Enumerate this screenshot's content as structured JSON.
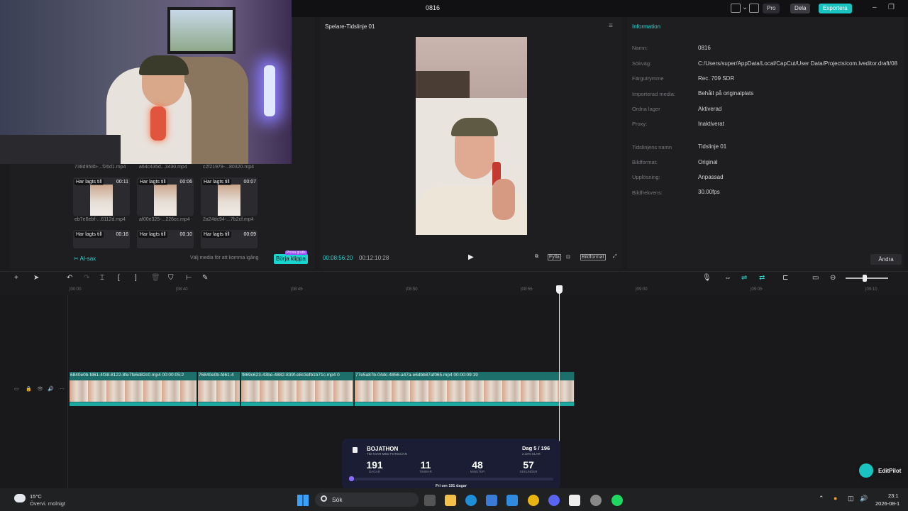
{
  "window": {
    "title": "0816",
    "pro_label": "Pro",
    "share_label": "Dela",
    "export_label": "Exportera"
  },
  "media": {
    "thumbs": [
      {
        "badge": "Har lagts till",
        "duration": "00:11",
        "filename": "eb7e6ebf-...6112d.mp4"
      },
      {
        "badge": "Har lagts till",
        "duration": "00:06",
        "filename": "af00e325-...226cc.mp4"
      },
      {
        "badge": "Har lagts till",
        "duration": "00:07",
        "filename": "2a24dc94-...7b2cf.mp4"
      },
      {
        "badge": "Har lagts till",
        "duration": "00:16",
        "filename": ""
      },
      {
        "badge": "Har lagts till",
        "duration": "00:10",
        "filename": ""
      },
      {
        "badge": "Har lagts till",
        "duration": "00:09",
        "filename": ""
      }
    ],
    "top_filenames": [
      "738d958b-...f26d1.mp4",
      "a64c435d...3430.mp4",
      "c2f21979-...80320.mp4"
    ],
    "ai_label": "AI-sax",
    "hint": "Välj media för att komma igång",
    "start_button": "Börja klippa",
    "trial_badge": "Prova gratis"
  },
  "player": {
    "title": "Spelare-Tidslinje 01",
    "current_time": "00:08:56:20",
    "total_time": "00:12:10:28",
    "fullscreen_label": "Fylla",
    "ratio_label": "Bildformat"
  },
  "info": {
    "title": "Information",
    "rows": [
      {
        "label": "Namn:",
        "value": "0816"
      },
      {
        "label": "Sökväg:",
        "value": "C:/Users/super/AppData/Local/CapCut/User Data/Projects/com.lveditor.draft/08"
      },
      {
        "label": "Färgutrymme",
        "value": "Rec. 709 SDR"
      },
      {
        "label": "Importerad media:",
        "value": "Behåll på originalplats"
      },
      {
        "label": "Ordna lager",
        "value": "Aktiverad"
      },
      {
        "label": "Proxy:",
        "value": "Inaktiverat"
      },
      {
        "label": "Tidslinjens namn",
        "value": "Tidslinje 01"
      },
      {
        "label": "Bildformat:",
        "value": "Original"
      },
      {
        "label": "Upplösning:",
        "value": "Anpassad"
      },
      {
        "label": "Bildfrekvens:",
        "value": "30.00fps"
      }
    ],
    "edit_button": "Ändra"
  },
  "timeline": {
    "ruler_ticks": [
      "|00:00",
      "|08:40",
      "|08:45",
      "|08:50",
      "|08:55",
      "|09:00",
      "|09:05",
      "|09:10"
    ],
    "clips": [
      {
        "label": "6840e0b-fd61-4f38-8122-8fe7fe6d82c0.mp4  00:00:05:2"
      },
      {
        "label": "76840e0b-fd61-4"
      },
      {
        "label": "f869c623-43be-4882-839f-e8c3efb1b71c.mp4  0"
      },
      {
        "label": "77e5a87b-04dc-4856-a47a-e6dbb87af065.mp4  00:00:09:19"
      }
    ]
  },
  "bojathon": {
    "title": "BOJATHON",
    "subtitle": "TID KVAR MED FOTBOJAN",
    "day": "Dag 5 / 196",
    "done": "2.33% KLAR",
    "days": "191",
    "days_label": "DAGAR",
    "hours": "11",
    "hours_label": "TIMMAR",
    "minutes": "48",
    "minutes_label": "MINUTER",
    "seconds": "57",
    "seconds_label": "SEKUNDER",
    "footer": "Fri om 191 dagar",
    "progress_pct": 2.33
  },
  "editpilot": {
    "label": "EditPilot"
  },
  "taskbar": {
    "temp": "15°C",
    "condition": "Övervi. molnigt",
    "search": "Sök",
    "time": "23:1",
    "date": "2026-08-1"
  },
  "colors": {
    "accent": "#18c3c0",
    "bojathon_bg": "#1a1d33",
    "clip": "#1c6f6b"
  }
}
